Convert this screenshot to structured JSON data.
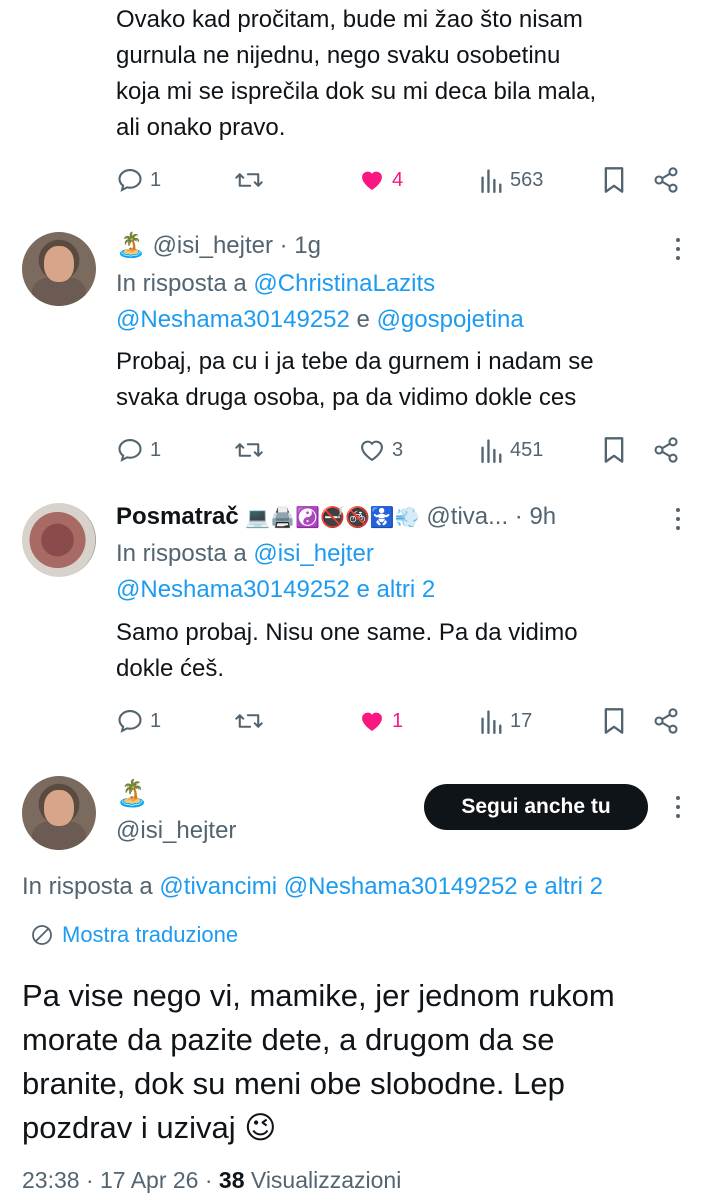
{
  "tweet1": {
    "text_lines": [
      "Ovako kad pročitam, bude mi žao što nisam",
      "gurnula ne nijednu, nego svaku osobetinu",
      "koja mi se isprečila dok su mi deca bila mala,",
      "ali onako pravo."
    ],
    "replies": "1",
    "likes": "4",
    "views": "563"
  },
  "tweet2": {
    "name_emoji": "🏝️",
    "handle_time": "@isi_hejter · 1g",
    "reply_prefix": "In risposta a",
    "reply_to_1": "@ChristinaLazits",
    "reply_to_2": "@Neshama30149252",
    "reply_and": "e",
    "reply_to_3": "@gospojetina",
    "text_lines": [
      "Probaj, pa cu i ja tebe da gurnem i nadam se",
      "svaka druga osoba, pa da vidimo dokle ces"
    ],
    "replies": "1",
    "likes": "3",
    "views": "451"
  },
  "tweet3": {
    "name": "Posmatrač",
    "emojis": "💻🖨️☯️🚭🚳🚼💨",
    "handle_time": "@tiva... · 9h",
    "reply_prefix": "In risposta a",
    "reply_to_1": "@isi_hejter",
    "reply_to_2": "@Neshama30149252",
    "reply_others": "e altri 2",
    "text_lines": [
      "Samo probaj. Nisu one same. Pa da vidimo",
      "dokle ćeš."
    ],
    "replies": "1",
    "likes": "1",
    "views": "17"
  },
  "main": {
    "name_emoji": "🏝️",
    "handle": "@isi_hejter",
    "follow_label": "Segui anche tu",
    "reply_prefix": "In risposta a",
    "reply_to_1": "@tivancimi",
    "reply_to_2": "@Neshama30149252",
    "reply_others": "e altri 2",
    "translate_label": "Mostra traduzione",
    "text_lines": [
      "Pa vise nego vi, mamike, jer jednom rukom",
      "morate da pazite dete, a drugom da se",
      "branite, dok su meni obe slobodne. Lep",
      "pozdrav i uzivaj 😉"
    ],
    "time_date": "23:38 · 17 Apr 26 ·",
    "views_count": "38",
    "views_label": "Visualizzazioni"
  },
  "colors": {
    "text": "#0f1419",
    "secondary": "#536471",
    "link": "#1d9bf0",
    "like_active": "#f91880"
  },
  "icons": [
    "reply-icon",
    "retweet-icon",
    "like-icon",
    "views-icon",
    "bookmark-icon",
    "share-icon",
    "more-icon",
    "globe-icon"
  ]
}
